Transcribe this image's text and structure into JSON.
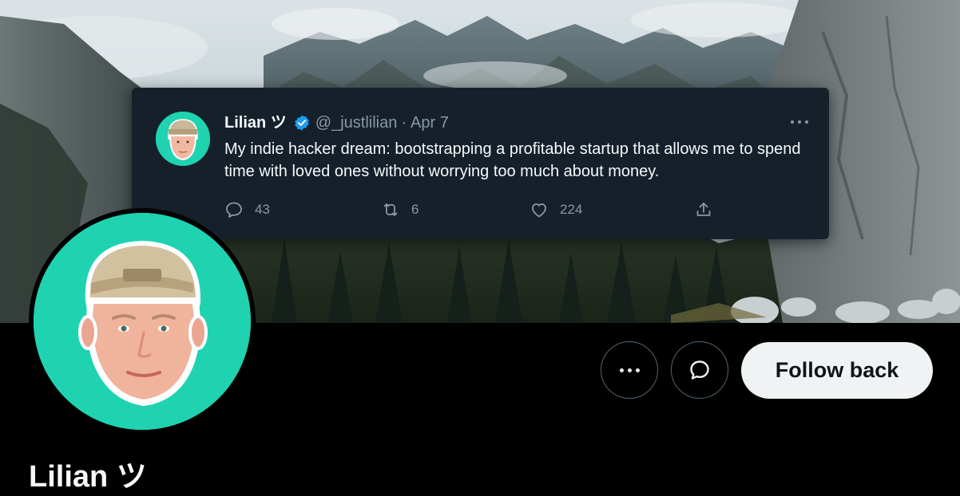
{
  "profile": {
    "display_name": "Lilian ツ"
  },
  "pinned_tweet": {
    "name": "Lilian ツ",
    "handle": "@_justlilian",
    "separator": "·",
    "date": "Apr 7",
    "text": "My indie hacker dream: bootstrapping a profitable startup that allows me to spend time with loved ones without worrying too much about money.",
    "reply_count": "43",
    "retweet_count": "6",
    "like_count": "224"
  },
  "actions": {
    "follow_label": "Follow back"
  },
  "icons": {
    "verified": "verified-badge-icon",
    "more": "more-icon",
    "message": "message-icon",
    "reply": "reply-icon",
    "retweet": "retweet-icon",
    "like": "heart-icon",
    "share": "share-icon"
  },
  "colors": {
    "background": "#000000",
    "card": "#15202b",
    "avatar_bg": "#1fd3b0",
    "verified": "#1d9bf0",
    "muted_text": "#8b98a5",
    "follow_button": "#eff3f4"
  }
}
